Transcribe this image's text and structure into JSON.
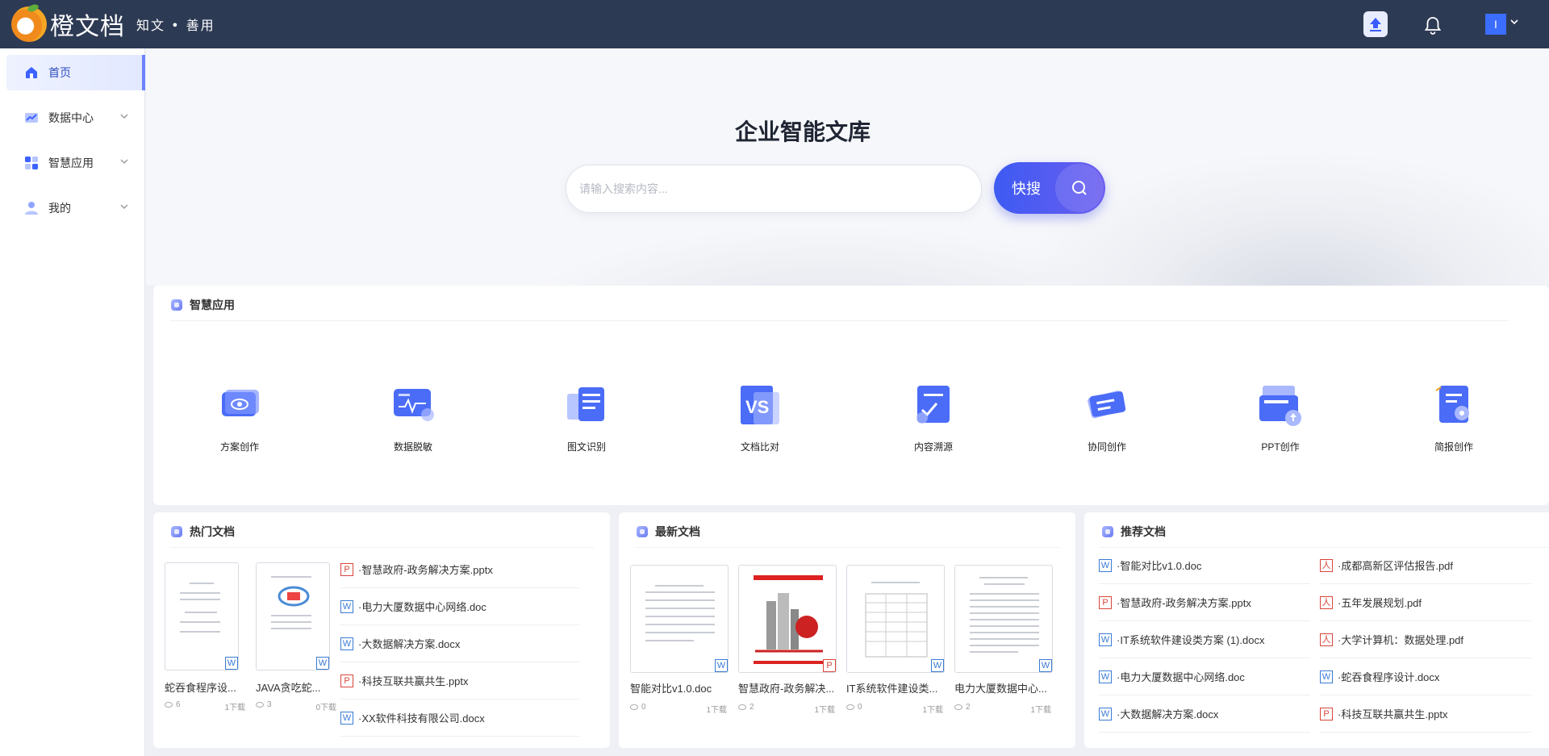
{
  "header": {
    "logo_name": "橙文档",
    "slogan": "知文 • 善用",
    "avatar_letter": "I"
  },
  "sidebar": {
    "items": [
      {
        "label": "首页",
        "active": true
      },
      {
        "label": "数据中心"
      },
      {
        "label": "智慧应用"
      },
      {
        "label": "我的"
      }
    ]
  },
  "hero": {
    "title": "企业智能文库",
    "search_placeholder": "请输入搜索内容...",
    "search_button": "快搜"
  },
  "apps_card": {
    "title": "智慧应用",
    "items": [
      "方案创作",
      "数据脱敏",
      "图文识别",
      "文档比对",
      "内容溯源",
      "协同创作",
      "PPT创作",
      "简报创作"
    ]
  },
  "hot_docs": {
    "title": "热门文档",
    "thumbs": [
      {
        "name": "蛇吞食程序设...",
        "views": "6",
        "downloads": "1下载",
        "type": "W"
      },
      {
        "name": "JAVA贪吃蛇...",
        "views": "3",
        "downloads": "0下载",
        "type": "W"
      }
    ],
    "list": [
      {
        "name": "·智慧政府-政务解决方案.pptx",
        "type": "P"
      },
      {
        "name": "·电力大厦数据中心网络.doc",
        "type": "W"
      },
      {
        "name": "·大数据解决方案.docx",
        "type": "W"
      },
      {
        "name": "·科技互联共赢共生.pptx",
        "type": "P"
      },
      {
        "name": "·XX软件科技有限公司.docx",
        "type": "W"
      }
    ]
  },
  "new_docs": {
    "title": "最新文档",
    "thumbs": [
      {
        "name": "智能对比v1.0.doc",
        "views": "0",
        "downloads": "1下载",
        "type": "W"
      },
      {
        "name": "智慧政府-政务解决...",
        "views": "2",
        "downloads": "1下载",
        "type": "P"
      },
      {
        "name": "IT系统软件建设类...",
        "views": "0",
        "downloads": "1下载",
        "type": "W"
      },
      {
        "name": "电力大厦数据中心...",
        "views": "2",
        "downloads": "1下载",
        "type": "W"
      }
    ]
  },
  "rec_docs": {
    "title": "推荐文档",
    "left": [
      {
        "name": "·智能对比v1.0.doc",
        "type": "W"
      },
      {
        "name": "·智慧政府-政务解决方案.pptx",
        "type": "P"
      },
      {
        "name": "·IT系统软件建设类方案 (1).docx",
        "type": "W"
      },
      {
        "name": "·电力大厦数据中心网络.doc",
        "type": "W"
      },
      {
        "name": "·大数据解决方案.docx",
        "type": "W"
      }
    ],
    "right": [
      {
        "name": "·成都高新区评估报告.pdf",
        "type": "人"
      },
      {
        "name": "·五年发展规划.pdf",
        "type": "人"
      },
      {
        "name": "·大学计算机：数据处理.pdf",
        "type": "人"
      },
      {
        "name": "·蛇吞食程序设计.docx",
        "type": "W"
      },
      {
        "name": "·科技互联共赢共生.pptx",
        "type": "P"
      }
    ]
  }
}
